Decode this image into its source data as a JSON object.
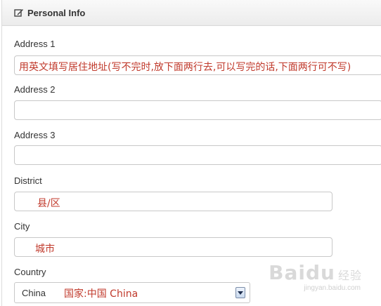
{
  "panel": {
    "title": "Personal Info",
    "icon": "edit-icon"
  },
  "fields": {
    "address1": {
      "label": "Address 1",
      "value": "",
      "hint": "用英文填写居住地址(写不完时,放下面两行去,可以写完的话,下面两行可不写)"
    },
    "address2": {
      "label": "Address 2",
      "value": ""
    },
    "address3": {
      "label": "Address 3",
      "value": ""
    },
    "district": {
      "label": "District",
      "value": "",
      "hint": "县/区"
    },
    "city": {
      "label": "City",
      "value": "",
      "hint": "城市"
    },
    "country": {
      "label": "Country",
      "selected": "China",
      "hint": "国家:中国 China"
    }
  },
  "watermark": {
    "brand": "Baidu",
    "suffix": "经验",
    "url": "jingyan.baidu.com"
  },
  "colors": {
    "annotation": "#c0392b",
    "heading_bg": "#ececec",
    "border": "#c8c8c8"
  }
}
